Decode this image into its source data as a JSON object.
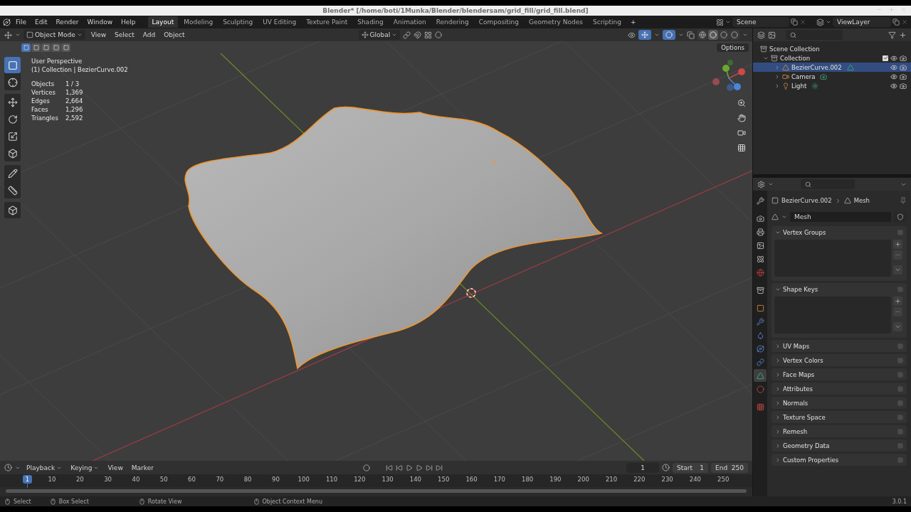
{
  "window": {
    "title": "Blender* [/home/boti/1Munka/Blender/blendersam/grid_fill/grid_fill.blend]"
  },
  "menu_bar": {
    "menus": [
      "File",
      "Edit",
      "Render",
      "Window",
      "Help"
    ],
    "workspaces": [
      {
        "label": "Layout",
        "selected": true
      },
      {
        "label": "Modeling",
        "selected": false
      },
      {
        "label": "Sculpting",
        "selected": false
      },
      {
        "label": "UV Editing",
        "selected": false
      },
      {
        "label": "Texture Paint",
        "selected": false
      },
      {
        "label": "Shading",
        "selected": false
      },
      {
        "label": "Animation",
        "selected": false
      },
      {
        "label": "Rendering",
        "selected": false
      },
      {
        "label": "Compositing",
        "selected": false
      },
      {
        "label": "Geometry Nodes",
        "selected": false
      },
      {
        "label": "Scripting",
        "selected": false
      }
    ],
    "add_workspace": "+",
    "scene": "Scene",
    "view_layer": "ViewLayer"
  },
  "viewport": {
    "header": {
      "mode": "Object Mode",
      "menus": [
        "View",
        "Select",
        "Add",
        "Object"
      ],
      "orientation": "Global",
      "shading_modes": [
        {
          "selected": false
        },
        {
          "selected": true
        },
        {
          "selected": false
        },
        {
          "selected": false
        }
      ]
    },
    "select_modes": [
      {
        "selected": true
      },
      {
        "selected": false
      },
      {
        "selected": false
      },
      {
        "selected": false
      },
      {
        "selected": false
      }
    ],
    "options": "Options",
    "info": {
      "perspective": "User Perspective",
      "context": "(1) Collection | BezierCurve.002",
      "stats": [
        {
          "label": "Objects",
          "value": "1 / 3"
        },
        {
          "label": "Vertices",
          "value": "1,369"
        },
        {
          "label": "Edges",
          "value": "2,664"
        },
        {
          "label": "Faces",
          "value": "1,296"
        },
        {
          "label": "Triangles",
          "value": "2,592"
        }
      ]
    },
    "tool_groups": [
      [
        {
          "kind": "select",
          "selected": true
        },
        {
          "kind": "cursor",
          "selected": false
        }
      ],
      [
        {
          "kind": "move",
          "selected": false
        },
        {
          "kind": "rotate",
          "selected": false
        },
        {
          "kind": "scale",
          "selected": false
        },
        {
          "kind": "transform",
          "selected": false
        }
      ],
      [
        {
          "kind": "annotate",
          "selected": false
        },
        {
          "kind": "measure",
          "selected": false
        }
      ],
      [
        {
          "kind": "add-cube",
          "selected": false
        }
      ]
    ]
  },
  "outliner": {
    "root": "Scene Collection",
    "collections": [
      {
        "name": "Collection",
        "expanded": true,
        "checked": true,
        "objects": [
          {
            "name": "BezierCurve.002",
            "kind": "mesh",
            "selected": true,
            "expanded": false
          },
          {
            "name": "Camera",
            "kind": "camera",
            "selected": false,
            "expanded": false
          },
          {
            "name": "Light",
            "kind": "light",
            "selected": false,
            "expanded": false
          }
        ]
      }
    ]
  },
  "properties": {
    "tab_groups": [
      [
        {
          "kind": "tool",
          "selected": false
        }
      ],
      [
        {
          "kind": "render",
          "selected": false
        },
        {
          "kind": "output",
          "selected": false
        },
        {
          "kind": "view-layer",
          "selected": false
        },
        {
          "kind": "scene",
          "selected": false
        },
        {
          "kind": "world",
          "selected": false
        }
      ],
      [
        {
          "kind": "collection",
          "selected": false
        }
      ],
      [
        {
          "kind": "object",
          "selected": false
        },
        {
          "kind": "modifiers",
          "selected": false
        },
        {
          "kind": "particles",
          "selected": false
        },
        {
          "kind": "physics",
          "selected": false
        },
        {
          "kind": "constraints",
          "selected": false
        },
        {
          "kind": "data",
          "selected": true
        },
        {
          "kind": "material",
          "selected": false
        }
      ],
      [
        {
          "kind": "texture",
          "selected": false
        }
      ]
    ],
    "object": "BezierCurve.002",
    "data": "Mesh",
    "data_block": "Mesh",
    "panels": [
      {
        "title": "Vertex Groups",
        "expanded": true
      },
      {
        "title": "Shape Keys",
        "expanded": true
      },
      {
        "title": "UV Maps",
        "expanded": false
      },
      {
        "title": "Vertex Colors",
        "expanded": false
      },
      {
        "title": "Face Maps",
        "expanded": false
      },
      {
        "title": "Attributes",
        "expanded": false
      },
      {
        "title": "Normals",
        "expanded": false
      },
      {
        "title": "Texture Space",
        "expanded": false
      },
      {
        "title": "Remesh",
        "expanded": false
      },
      {
        "title": "Geometry Data",
        "expanded": false
      },
      {
        "title": "Custom Properties",
        "expanded": false
      }
    ]
  },
  "timeline": {
    "menus": [
      {
        "label": "Playback",
        "dropdown": true
      },
      {
        "label": "Keying",
        "dropdown": true
      },
      {
        "label": "View",
        "dropdown": false
      },
      {
        "label": "Marker",
        "dropdown": false
      }
    ],
    "current_frame": "1",
    "start_label": "Start",
    "start": "1",
    "end_label": "End",
    "end": "250",
    "playhead": "1",
    "ticks": [
      "10",
      "20",
      "30",
      "40",
      "50",
      "60",
      "70",
      "80",
      "90",
      "100",
      "110",
      "120",
      "130",
      "140",
      "150",
      "160",
      "170",
      "180",
      "190",
      "200",
      "210",
      "220",
      "230",
      "240",
      "250"
    ]
  },
  "status_bar": {
    "hints": [
      "Select",
      "Box Select",
      "Rotate View",
      "Object Context Menu"
    ],
    "version": "3.0.1"
  }
}
